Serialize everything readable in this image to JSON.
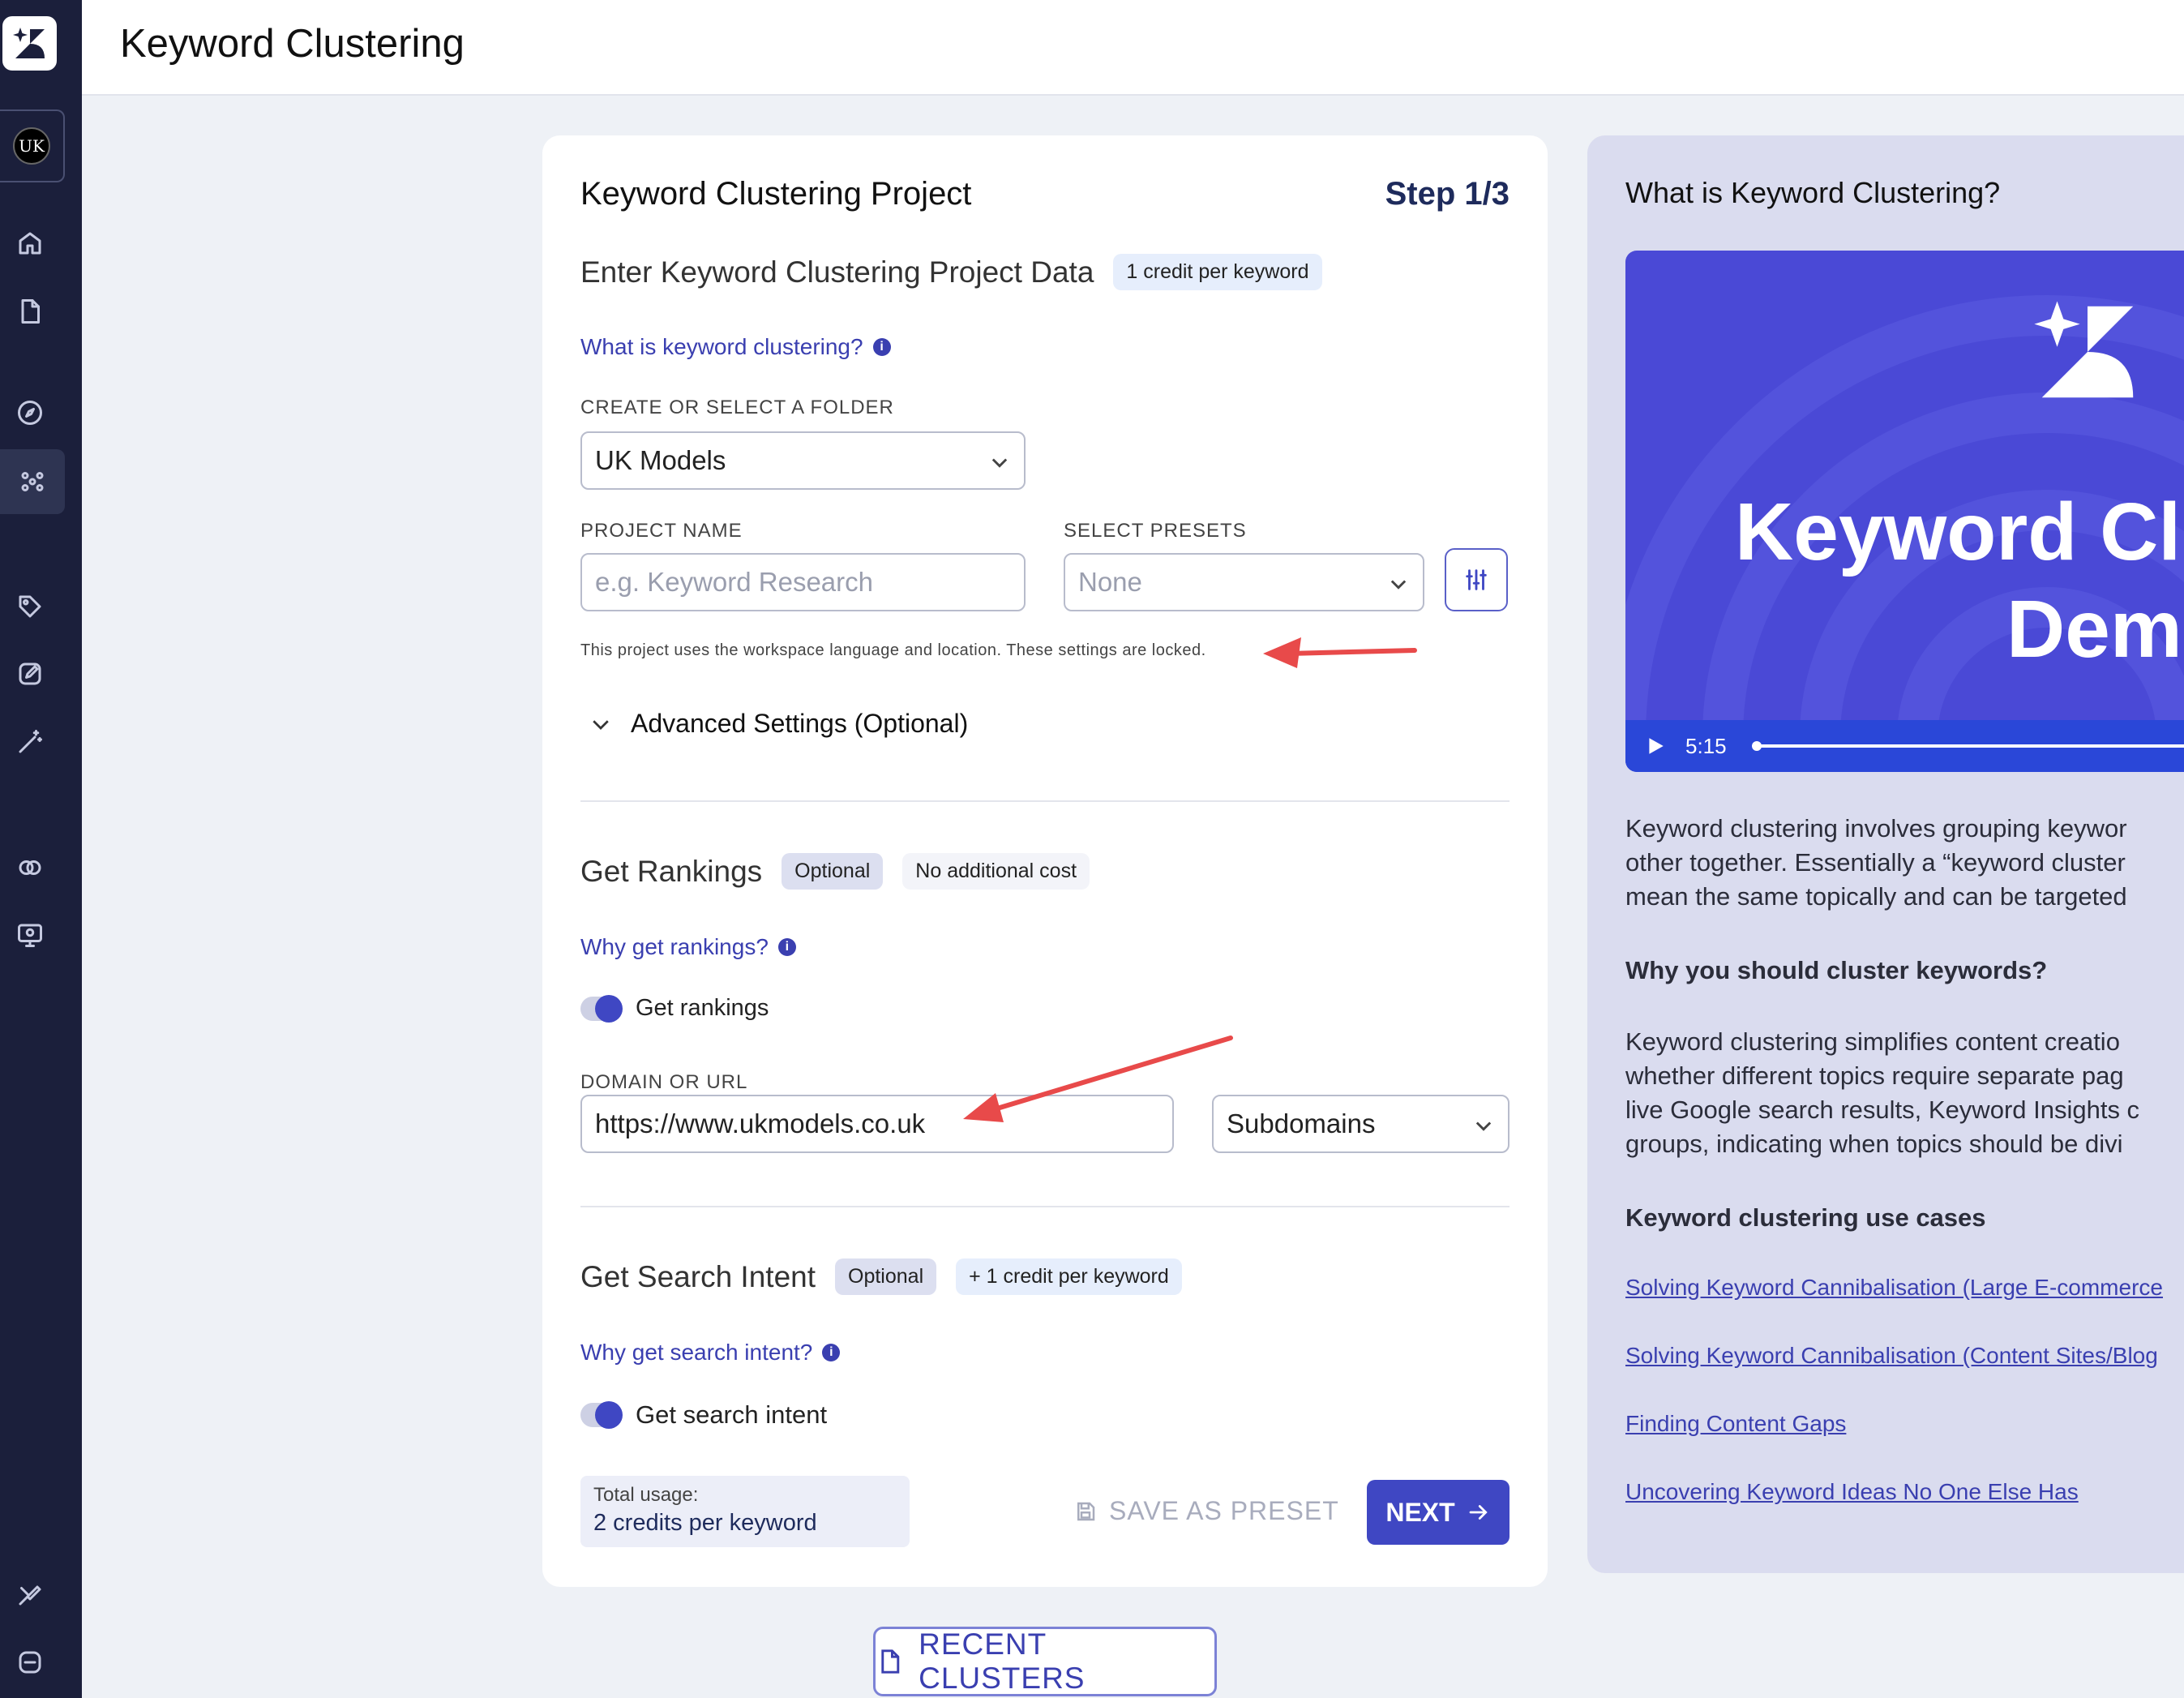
{
  "header": {
    "title": "Keyword Clustering"
  },
  "sidebar": {
    "workspace_initials": "UK",
    "items": [
      {
        "icon": "home-icon"
      },
      {
        "icon": "file-icon"
      },
      {
        "icon": "compass-icon"
      },
      {
        "icon": "cluster-icon",
        "active": true
      },
      {
        "icon": "tag-icon"
      },
      {
        "icon": "edit-icon"
      },
      {
        "icon": "magic-wand-icon"
      },
      {
        "icon": "link-icon"
      },
      {
        "icon": "monitor-icon"
      },
      {
        "icon": "brush-icon"
      },
      {
        "icon": "logout-icon"
      }
    ]
  },
  "card": {
    "title": "Keyword Clustering Project",
    "step": "Step 1/3",
    "subtitle": "Enter Keyword Clustering Project Data",
    "credit_badge": "1 credit per keyword",
    "what_link": "What is keyword clustering?",
    "folder_label": "CREATE OR SELECT A FOLDER",
    "folder_value": "UK Models",
    "project_name_label": "PROJECT NAME",
    "project_name_placeholder": "e.g. Keyword  Research",
    "presets_label": "SELECT PRESETS",
    "presets_value": "None",
    "locked_note": "This project uses the workspace language and location. These settings are locked.",
    "advanced_label": "Advanced Settings (Optional)",
    "rankings": {
      "title": "Get Rankings",
      "optional_badge": "Optional",
      "cost_badge": "No additional cost",
      "why_link": "Why get rankings?",
      "toggle_label": "Get rankings",
      "toggle_on": true,
      "domain_label": "DOMAIN OR URL",
      "domain_value": "https://www.ukmodels.co.uk",
      "scope_value": "Subdomains"
    },
    "intent": {
      "title": "Get Search Intent",
      "optional_badge": "Optional",
      "cost_badge": "+ 1 credit per keyword",
      "why_link": "Why get search intent?",
      "toggle_label": "Get search intent",
      "toggle_on": true
    },
    "usage": {
      "label": "Total usage:",
      "value": "2 credits per keyword"
    },
    "save_preset": "SAVE AS PRESET",
    "next": "NEXT"
  },
  "recent_clusters": "RECENT CLUSTERS",
  "panel": {
    "title": "What is Keyword Clustering?",
    "video": {
      "title_line1": "Keyword Clu",
      "title_line2": "Dem",
      "time": "5:15"
    },
    "intro_lines": [
      "Keyword clustering involves grouping keywor",
      "other together. Essentially a “keyword cluster",
      "mean the same topically and can be targeted"
    ],
    "why_heading": "Why you should cluster keywords?",
    "why_lines": [
      "Keyword clustering simplifies content creatio",
      "whether different topics require separate pag",
      "live Google search results, Keyword Insights c",
      "groups, indicating when topics should be divi"
    ],
    "use_cases_heading": "Keyword clustering use cases",
    "use_cases": [
      "Solving Keyword Cannibalisation (Large E-commerce",
      "Solving Keyword Cannibalisation (Content Sites/Blog",
      "Finding Content Gaps",
      "Uncovering Keyword Ideas No One Else Has"
    ]
  },
  "colors": {
    "accent": "#3f47c3",
    "sidebar": "#1b1f3b",
    "annotation": "#e84a4a"
  }
}
